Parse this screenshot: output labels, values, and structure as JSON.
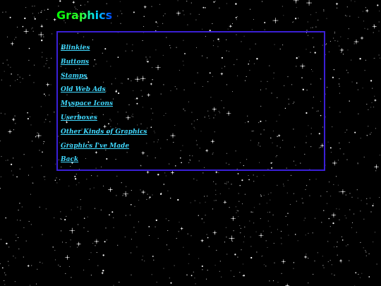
{
  "page": {
    "title": "Graphics",
    "background": "starfield",
    "colors": {
      "background": "#000000",
      "link": "#40d9ff",
      "border": "#3a1fd6",
      "title_gradient": [
        "#00ff00",
        "#00e0ff",
        "#0044ff"
      ]
    }
  },
  "nav": {
    "links": [
      {
        "label": "Blinkies"
      },
      {
        "label": "Buttons"
      },
      {
        "label": "Stamps"
      },
      {
        "label": "Old Web Ads"
      },
      {
        "label": "Myspace Icons"
      },
      {
        "label": "Userboxes"
      },
      {
        "label": "Other Kinds of Graphics"
      },
      {
        "label": "Graphics I've Made"
      },
      {
        "label": "Back"
      }
    ]
  }
}
